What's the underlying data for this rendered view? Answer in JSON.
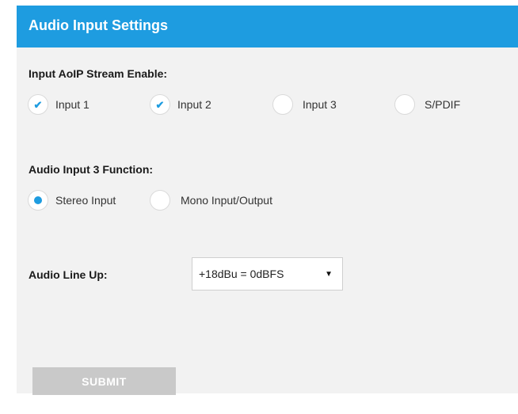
{
  "header": {
    "title": "Audio Input Settings"
  },
  "stream_enable": {
    "label": "Input AoIP Stream Enable:",
    "options": [
      {
        "label": "Input 1",
        "checked": true
      },
      {
        "label": "Input 2",
        "checked": true
      },
      {
        "label": "Input 3",
        "checked": false
      },
      {
        "label": "S/PDIF",
        "checked": false
      }
    ]
  },
  "input3_function": {
    "label": "Audio Input 3 Function:",
    "options": [
      {
        "label": "Stereo Input",
        "selected": true
      },
      {
        "label": "Mono Input/Output",
        "selected": false
      }
    ]
  },
  "line_up": {
    "label": "Audio Line Up:",
    "selected_value": "+18dBu = 0dBFS",
    "dropdown_icon": "caret-down-icon"
  },
  "submit": {
    "label": "SUBMIT"
  },
  "colors": {
    "accent": "#1e9ce0",
    "panel_bg": "#f2f2f2",
    "submit_bg": "#c9c9c9"
  }
}
